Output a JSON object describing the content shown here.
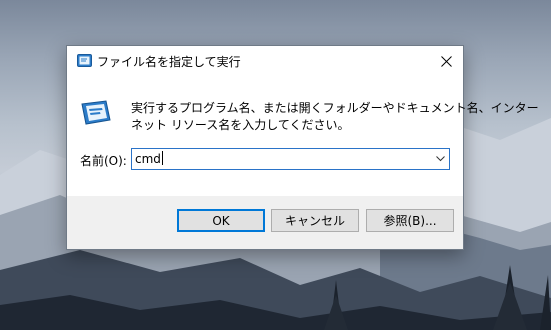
{
  "dialog": {
    "title": "ファイル名を指定して実行",
    "description_line1": "実行するプログラム名、または開くフォルダーやドキュメント名、インター",
    "description_line2": "ネット リソース名を入力してください。",
    "open_label": "名前(O):",
    "command_value": "cmd",
    "ok_label": "OK",
    "cancel_label": "キャンセル",
    "browse_label": "参照(B)...",
    "accent_color": "#0078d7"
  }
}
